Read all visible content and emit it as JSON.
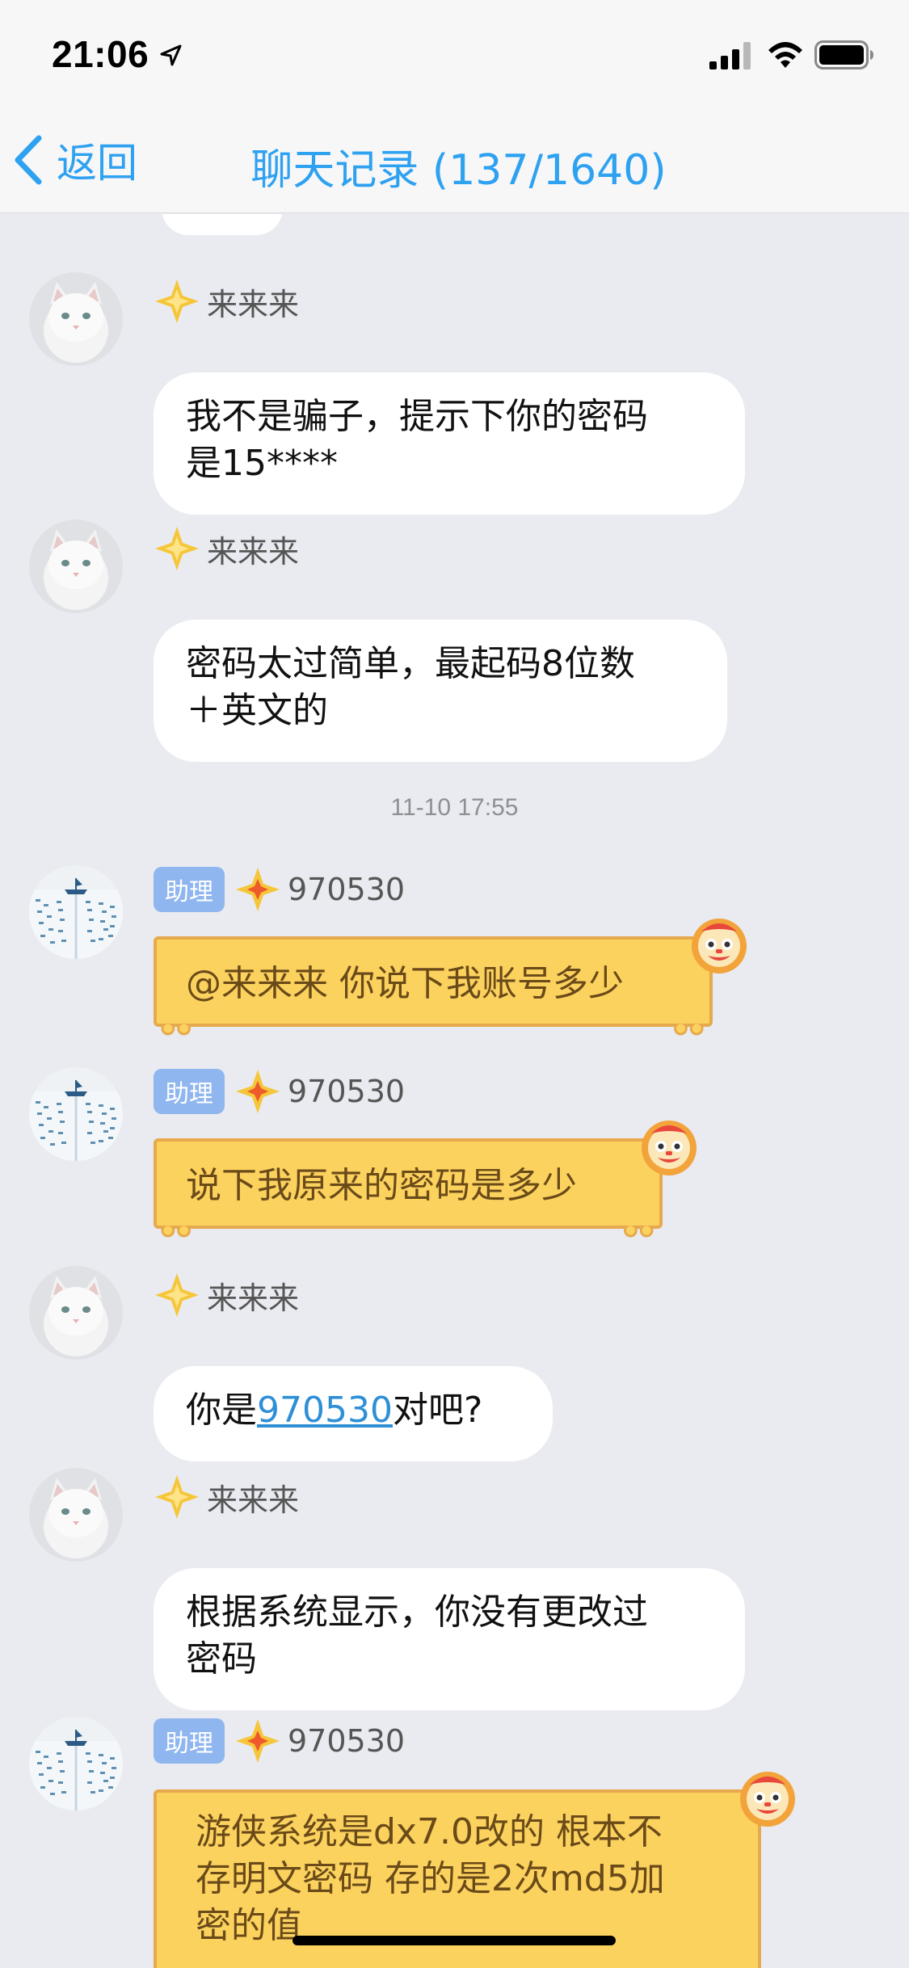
{
  "status_bar": {
    "time": "21:06"
  },
  "nav": {
    "back_label": "返回",
    "title": "聊天记录 (137/1640)"
  },
  "messages": [
    {
      "name": "来来来",
      "lines": [
        "我不是骗子，提示下你的密码",
        "是15****"
      ]
    },
    {
      "name": "来来来",
      "lines": [
        "密码太过简单，最起码8位数",
        "＋英文的"
      ]
    },
    {
      "timestamp": "11-10 17:55"
    },
    {
      "badge": "助理",
      "name": "970530",
      "lines": [
        "@来来来 你说下我账号多少"
      ]
    },
    {
      "badge": "助理",
      "name": "970530",
      "lines": [
        "说下我原来的密码是多少"
      ]
    },
    {
      "name": "来来来",
      "prefix": "你是",
      "link": "970530",
      "suffix": "对吧?"
    },
    {
      "name": "来来来",
      "lines": [
        "根据系统显示，你没有更改过",
        "密码"
      ]
    },
    {
      "badge": "助理",
      "name": "970530",
      "lines": [
        "游侠系统是dx7.0改的 根本不",
        "存明文密码 存的是2次md5加",
        "密的值"
      ]
    }
  ],
  "icons": {
    "cat_avatar": "cat-avatar-icon",
    "boat_avatar": "boat-avatar-icon",
    "star": "star-badge-icon",
    "lion": "lion-head-icon"
  },
  "colors": {
    "accent": "#2ea1f0",
    "gold_bubble": "#fcd25f",
    "badge": "#8fb6ef"
  }
}
